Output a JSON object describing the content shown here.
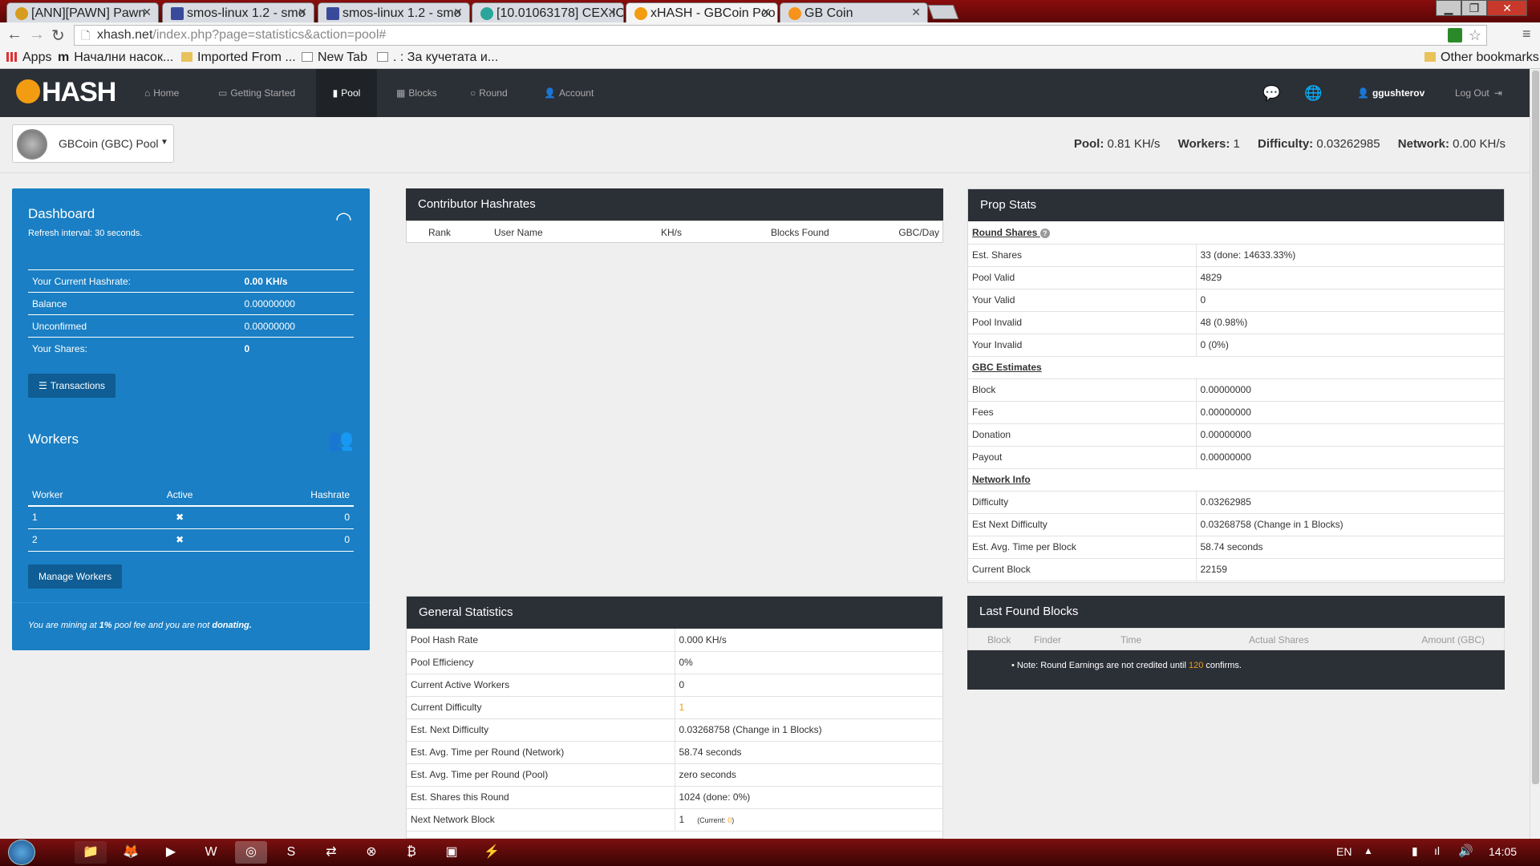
{
  "browser": {
    "tabs": [
      {
        "label": "[ANN][PAWN] Pawn",
        "color": "#d79b1e"
      },
      {
        "label": "smos-linux 1.2 - smo",
        "color": "#3a4a9b"
      },
      {
        "label": "smos-linux 1.2 - smo",
        "color": "#3a4a9b"
      },
      {
        "label": "[10.01063178] CEX.IO",
        "color": "#2aa59a"
      },
      {
        "label": "xHASH - GBCoin Poo",
        "color": "#f39c12"
      },
      {
        "label": "GB Coin",
        "color": "#f7931a"
      }
    ],
    "url_host": "xhash.net",
    "url_path": "/index.php?page=statistics&action=pool#",
    "bookmarks": [
      "Apps",
      "Начални насок...",
      "Imported From ...",
      "New Tab",
      ". : За кучетата и...",
      "Other bookmarks"
    ]
  },
  "site": {
    "logo": "HASH",
    "nav": [
      "Home",
      "Getting Started",
      "Pool",
      "Blocks",
      "Round",
      "Account"
    ],
    "user": "ggushterov",
    "logout": "Log Out"
  },
  "pool": {
    "selector": "GBCoin (GBC) Pool",
    "stats": [
      {
        "label": "Pool:",
        "value": "0.81 KH/s"
      },
      {
        "label": "Workers:",
        "value": "1"
      },
      {
        "label": "Difficulty:",
        "value": "0.03262985"
      },
      {
        "label": "Network:",
        "value": "0.00 KH/s"
      }
    ]
  },
  "dashboard": {
    "title": "Dashboard",
    "refresh": "Refresh interval: 30 seconds.",
    "rows": [
      {
        "label": "Your Current Hashrate:",
        "value": "0.00 KH/s"
      },
      {
        "label": "Balance",
        "value": "0.00000000"
      },
      {
        "label": "Unconfirmed",
        "value": "0.00000000"
      },
      {
        "label": "Your Shares:",
        "value": "0"
      }
    ],
    "transactions_btn": "Transactions",
    "workers_title": "Workers",
    "workers_headers": [
      "Worker",
      "Active",
      "Hashrate"
    ],
    "workers": [
      {
        "name": "1",
        "hashrate": "0"
      },
      {
        "name": "2",
        "hashrate": "0"
      }
    ],
    "manage_btn": "Manage Workers",
    "note_a": "You are mining at ",
    "note_b": "1%",
    "note_c": " pool fee and you are not ",
    "note_d": "donating."
  },
  "contrib": {
    "title": "Contributor Hashrates",
    "headers": [
      "Rank",
      "User Name",
      "KH/s",
      "Blocks Found",
      "GBC/Day"
    ]
  },
  "general": {
    "title": "General Statistics",
    "rows": [
      [
        "Pool Hash Rate",
        "0.000 KH/s"
      ],
      [
        "Pool Efficiency",
        "0%"
      ],
      [
        "Current Active Workers",
        "0"
      ],
      [
        "Current Difficulty",
        "1"
      ],
      [
        "Est. Next Difficulty",
        "0.03268758 (Change in 1 Blocks)"
      ],
      [
        "Est. Avg. Time per Round (Network)",
        "58.74 seconds"
      ],
      [
        "Est. Avg. Time per Round (Pool)",
        "zero seconds"
      ],
      [
        "Est. Shares this Round",
        "1024 (done: 0%)"
      ],
      [
        "Next Network Block",
        "1"
      ]
    ],
    "current_label": "(Current: ",
    "current_val": "0",
    "current_end": ")"
  },
  "prop": {
    "title": "Prop Stats",
    "sec_round": "Round Shares",
    "round": [
      [
        "Est. Shares",
        "33 (done: 14633.33%)"
      ],
      [
        "Pool Valid",
        "4829"
      ],
      [
        "Your Valid",
        "0"
      ],
      [
        "Pool Invalid",
        "48 (0.98%)"
      ],
      [
        "Your Invalid",
        "0 (0%)"
      ]
    ],
    "sec_est": "GBC Estimates",
    "est": [
      [
        "Block",
        "0.00000000"
      ],
      [
        "Fees",
        "0.00000000"
      ],
      [
        "Donation",
        "0.00000000"
      ],
      [
        "Payout",
        "0.00000000"
      ]
    ],
    "sec_net": "Network Info",
    "net": [
      [
        "Difficulty",
        "0.03262985"
      ],
      [
        "Est Next Difficulty",
        "0.03268758 (Change in 1 Blocks)"
      ],
      [
        "Est. Avg. Time per Block",
        "58.74 seconds"
      ],
      [
        "Current Block",
        "22159"
      ]
    ]
  },
  "lastblocks": {
    "title": "Last Found Blocks",
    "headers": [
      "Block",
      "Finder",
      "Time",
      "Actual Shares",
      "Amount (GBC)"
    ],
    "note_a": "Note: Round Earnings are not credited until ",
    "note_b": "120",
    "note_c": " confirms."
  },
  "taskbar": {
    "lang": "EN",
    "time": "14:05"
  },
  "colors": {
    "accent": "#1a7fc4",
    "nav": "#2b2f36",
    "highlight": "#f39c12"
  }
}
